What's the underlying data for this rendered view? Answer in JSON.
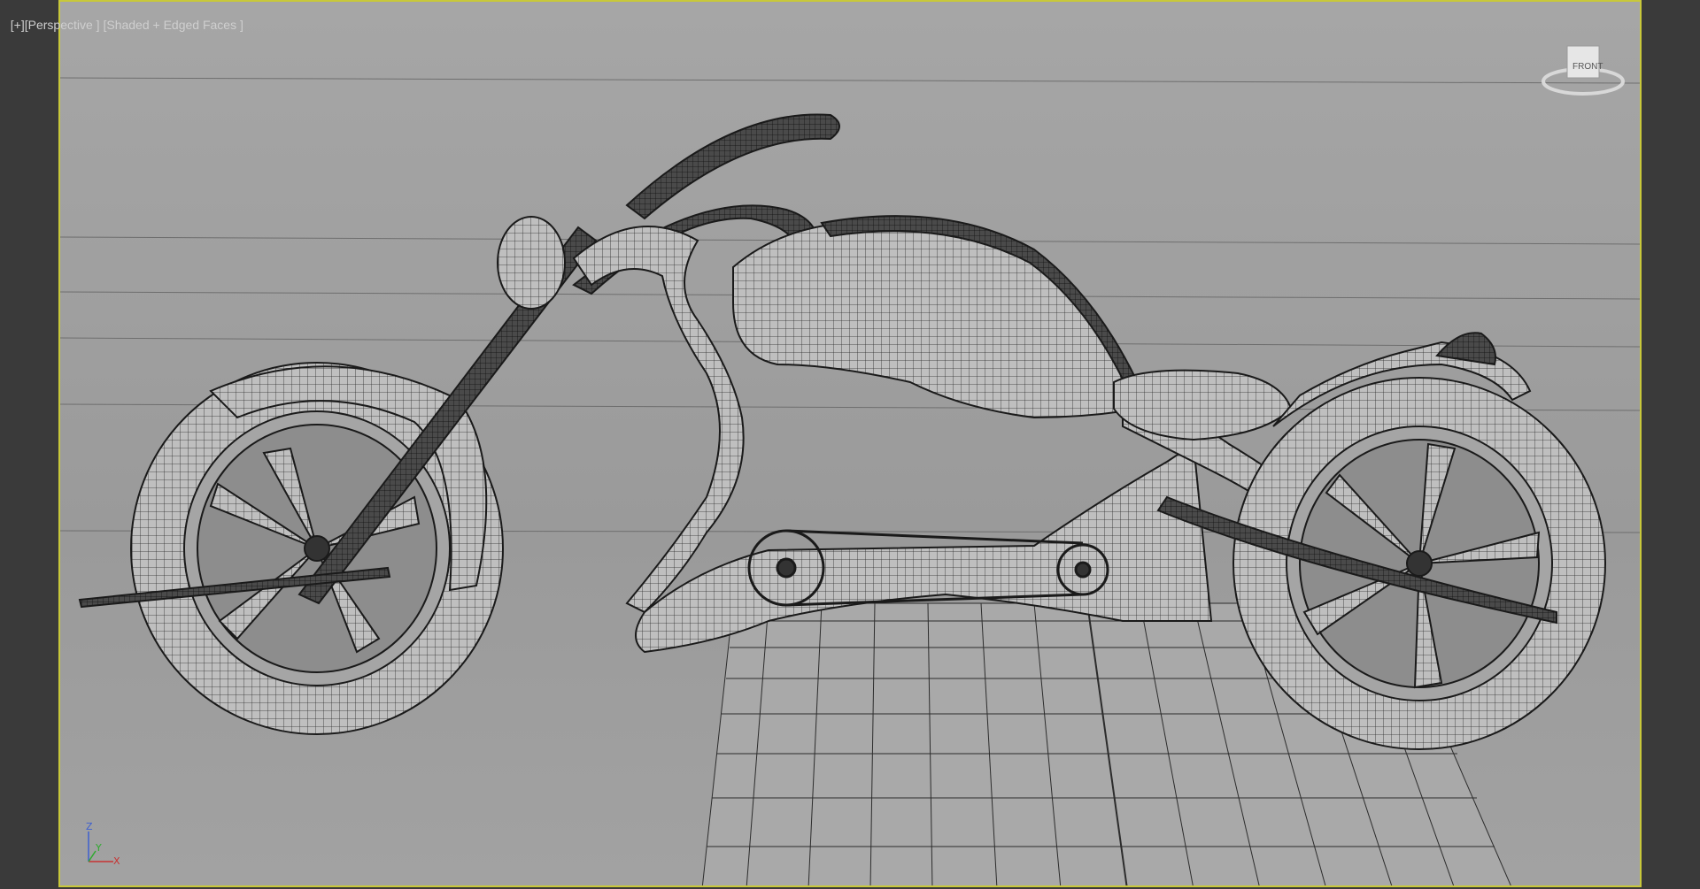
{
  "viewport": {
    "menu_plus": "[+]",
    "view_name": "[Perspective ]",
    "shading_mode": "[Shaded + Edged Faces ]"
  },
  "viewcube": {
    "face_label": "FRONT"
  },
  "axis_tripod": {
    "z_label": "Z",
    "y_label": "Y",
    "x_label": "X"
  },
  "colors": {
    "active_border": "#c8c83a",
    "viewport_bg": "#a2a2a2",
    "side_panel": "#3a3a3a",
    "wire": "#1e1e1e",
    "surface": "#bdbdbd"
  },
  "icons": [
    "viewcube-icon",
    "axis-tripod-icon"
  ]
}
